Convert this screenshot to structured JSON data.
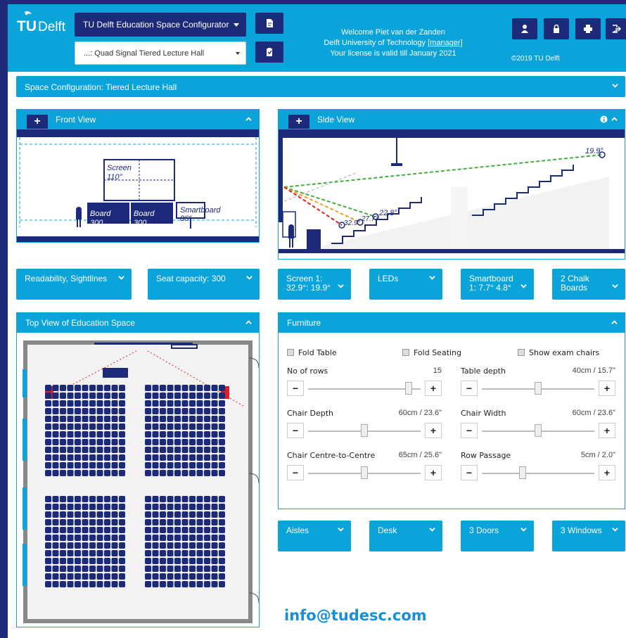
{
  "header": {
    "logo_text": "TUDelft",
    "app_select": "TU Delft Education Space Configurator",
    "space_select": "...: Quad Signal Tiered Lecture Hall",
    "welcome_line1": "Welcome Piet van der Zanden",
    "welcome_line2_prefix": "Delft University of Technology",
    "welcome_role": "[manager]",
    "welcome_line3": "Your license is valid till January 2021",
    "copyright": "©2019 TU Delft"
  },
  "config_bar": {
    "label": "Space Configuration: Tiered Lecture Hall"
  },
  "front_view": {
    "title": "Front View",
    "screen_label": "Screen",
    "screen_size": "110\"",
    "board1_label": "Board",
    "board1_value": "300",
    "board2_label": "Board",
    "board2_value": "300",
    "smartboard_label": "Smartboard",
    "smartboard_size": "86\""
  },
  "side_view": {
    "title": "Side View",
    "angle_top": "19.9°",
    "angle_mid": "22.8°",
    "angle_a": "32.9°",
    "angle_b": "27.7°"
  },
  "dropdowns_left": [
    {
      "line1": "Readability, Sightlines",
      "line2": ""
    },
    {
      "line1": "Seat capacity: 300",
      "line2": ""
    }
  ],
  "dropdowns_right": [
    {
      "line1": "Screen 1:",
      "line2": "32.9°:  19.9°"
    },
    {
      "line1": "LEDs",
      "line2": ""
    },
    {
      "line1": "Smartboard",
      "line2": "1:  7.7°  4.8°"
    },
    {
      "line1": "2 Chalk",
      "line2": "Boards"
    }
  ],
  "top_view": {
    "title": "Top View of Education Space"
  },
  "furniture": {
    "title": "Furniture",
    "checkboxes": [
      "Fold Table",
      "Fold Seating",
      "Show exam chairs"
    ],
    "sliders": [
      {
        "label": "No of rows",
        "value": "15",
        "level": 0.92
      },
      {
        "label": "Table depth",
        "value": "40cm / 15.7\"",
        "level": 0.5
      },
      {
        "label": "Chair Depth",
        "value": "60cm / 23.6\"",
        "level": 0.5
      },
      {
        "label": "Chair Width",
        "value": "60cm / 23.6\"",
        "level": 0.5
      },
      {
        "label": "Chair Centre-to-Centre",
        "value": "65cm / 25.6\"",
        "level": 0.5
      },
      {
        "label": "Row Passage",
        "value": "5cm / 2.0\"",
        "level": 0.35
      }
    ],
    "minus": "−",
    "plus": "+"
  },
  "bottom_dropdowns": [
    "Aisles",
    "Desk",
    "3 Doors",
    "3 Windows"
  ],
  "footer": {
    "email": "info@tudesc.com"
  },
  "colors": {
    "navy": "#1d2a7a",
    "cyan": "#0aa3da",
    "red": "#e02020"
  }
}
